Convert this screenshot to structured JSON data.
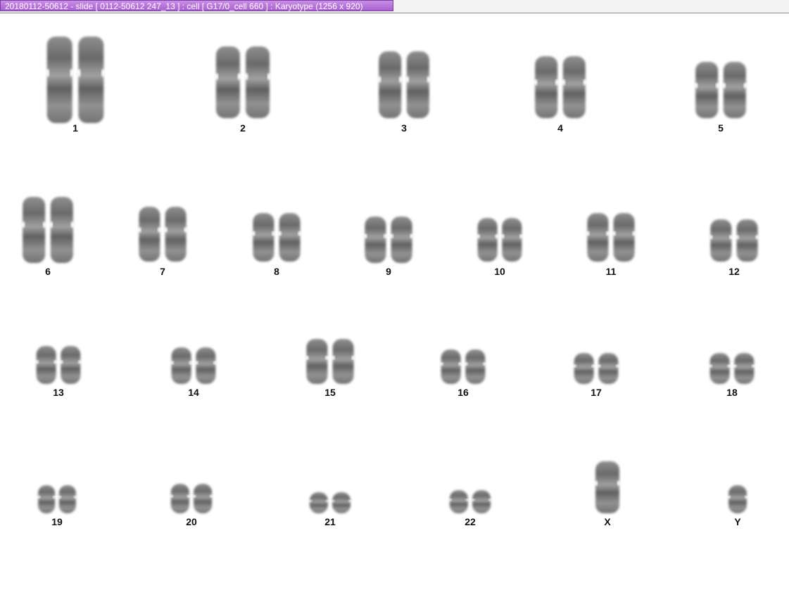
{
  "window": {
    "title": "20180112-50612 - slide [ 0112-50612 247_13 ] : cell [ G17/0_cell 660 ] : Karyotype  (1256 x 920)"
  },
  "karyotype": {
    "labels": [
      "1",
      "2",
      "3",
      "4",
      "5",
      "6",
      "7",
      "8",
      "9",
      "10",
      "11",
      "12",
      "13",
      "14",
      "15",
      "16",
      "17",
      "18",
      "19",
      "20",
      "21",
      "22",
      "X",
      "Y"
    ],
    "chromosome_color": "#555555"
  }
}
